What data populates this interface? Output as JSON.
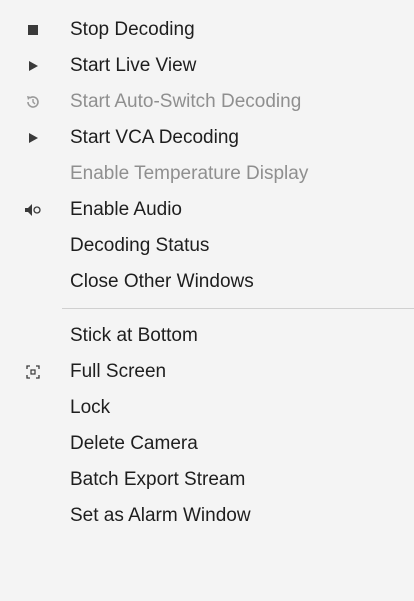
{
  "menu": {
    "items": [
      {
        "label": "Stop Decoding",
        "icon": "stop-icon",
        "enabled": true
      },
      {
        "label": "Start Live View",
        "icon": "play-icon",
        "enabled": true
      },
      {
        "label": "Start Auto-Switch Decoding",
        "icon": "auto-switch-icon",
        "enabled": false
      },
      {
        "label": "Start VCA Decoding",
        "icon": "play-icon",
        "enabled": true
      },
      {
        "label": "Enable Temperature Display",
        "icon": null,
        "enabled": false
      },
      {
        "label": "Enable Audio",
        "icon": "audio-icon",
        "enabled": true
      },
      {
        "label": "Decoding Status",
        "icon": null,
        "enabled": true
      },
      {
        "label": "Close Other Windows",
        "icon": null,
        "enabled": true
      }
    ],
    "items2": [
      {
        "label": "Stick at Bottom",
        "icon": null,
        "enabled": true
      },
      {
        "label": "Full Screen",
        "icon": "fullscreen-icon",
        "enabled": true
      },
      {
        "label": "Lock",
        "icon": null,
        "enabled": true
      },
      {
        "label": "Delete Camera",
        "icon": null,
        "enabled": true
      },
      {
        "label": "Batch Export Stream",
        "icon": null,
        "enabled": true
      },
      {
        "label": "Set as Alarm Window",
        "icon": null,
        "enabled": true
      }
    ],
    "colors": {
      "background": "#f4f4f4",
      "text": "#1e1e1e",
      "disabled_text": "#8f8f8f",
      "icon": "#3a3a3a",
      "separator": "#d0d0d0"
    }
  }
}
